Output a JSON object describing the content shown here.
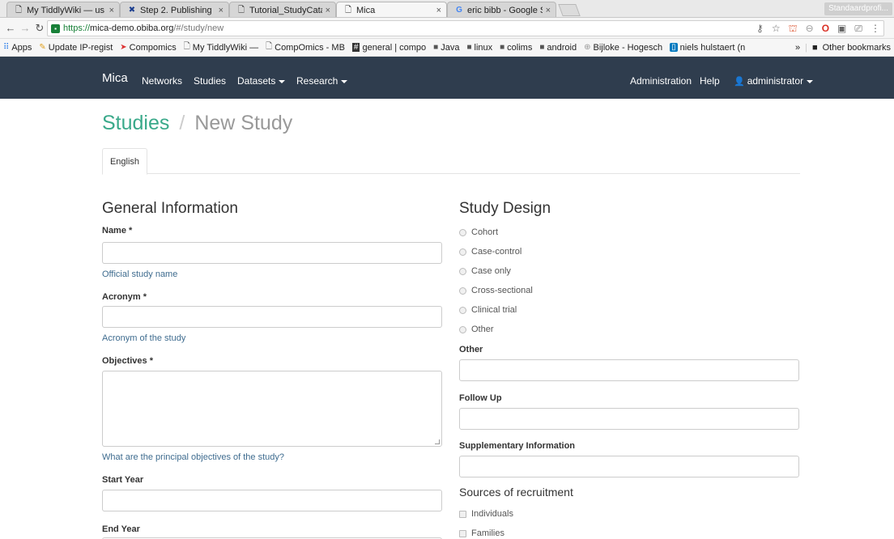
{
  "browser": {
    "tabs": [
      {
        "title": "My TiddlyWiki — us",
        "icon": "page-icon"
      },
      {
        "title": "Step 2. Publishing",
        "icon": "tool-icon"
      },
      {
        "title": "Tutorial_StudyCata",
        "icon": "page-icon"
      },
      {
        "title": "Mica",
        "icon": "page-icon",
        "active": true
      },
      {
        "title": "eric bibb - Google S",
        "icon": "google-icon"
      }
    ],
    "profile": "Standaardprofi...",
    "url_secure_part": "https://",
    "url_host": "mica-demo.obiba.org",
    "url_path": "/#/study/new",
    "bookmarks": [
      {
        "label": "Apps",
        "icon": "apps-icon"
      },
      {
        "label": "Update IP-regist",
        "icon": "bookmark-icon"
      },
      {
        "label": "Compomics",
        "icon": "bookmark-icon"
      },
      {
        "label": "My TiddlyWiki —",
        "icon": "page-icon"
      },
      {
        "label": "CompOmics - MB",
        "icon": "page-icon"
      },
      {
        "label": "general | compo",
        "icon": "slack-icon"
      },
      {
        "label": "Java",
        "icon": "folder-icon"
      },
      {
        "label": "linux",
        "icon": "folder-icon"
      },
      {
        "label": "colims",
        "icon": "folder-icon"
      },
      {
        "label": "android",
        "icon": "folder-icon"
      },
      {
        "label": "Bijloke - Hogesch",
        "icon": "globe-icon"
      },
      {
        "label": "niels hulstaert (n",
        "icon": "trello-icon"
      }
    ],
    "more_bookmarks": "»",
    "other_bookmarks": "Other bookmarks"
  },
  "navbar": {
    "brand": "Mica",
    "items": [
      "Networks",
      "Studies",
      "Datasets",
      "Research"
    ],
    "administration": "Administration",
    "help": "Help",
    "user": "administrator"
  },
  "breadcrumb": {
    "root": "Studies",
    "separator": "/",
    "current": "New Study"
  },
  "language_tab": "English",
  "general": {
    "title": "General Information",
    "name_label": "Name *",
    "name_help": "Official study name",
    "acronym_label": "Acronym *",
    "acronym_help": "Acronym of the study",
    "objectives_label": "Objectives *",
    "objectives_help": "What are the principal objectives of the study?",
    "start_year_label": "Start Year",
    "end_year_label": "End Year"
  },
  "design": {
    "title": "Study Design",
    "options": [
      "Cohort",
      "Case-control",
      "Case only",
      "Cross-sectional",
      "Clinical trial",
      "Other"
    ],
    "other_label": "Other",
    "follow_up_label": "Follow Up",
    "supplementary_label": "Supplementary Information"
  },
  "recruitment": {
    "title": "Sources of recruitment",
    "options": [
      "Individuals",
      "Families"
    ]
  }
}
